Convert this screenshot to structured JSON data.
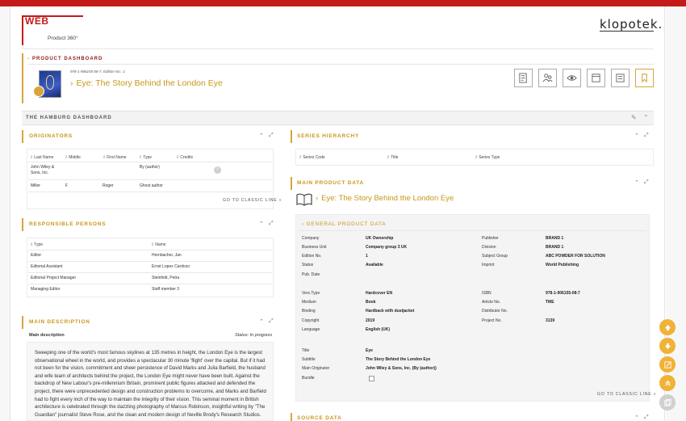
{
  "header": {
    "logo_web": "WEB",
    "logo_sub": "Product 360°",
    "brand": "klopotek."
  },
  "product_dashboard": {
    "label": "PRODUCT DASHBOARD",
    "isbn_line": "978-1-906155-08-7, Edition No.: 1",
    "title": "Eye: The Story Behind the London Eye",
    "tools": [
      "edit-document-icon",
      "users-icon",
      "eye-icon",
      "calendar-icon",
      "report-icon",
      "bookmark-icon"
    ]
  },
  "dashboard": {
    "title": "THE HAMBURG DASHBOARD"
  },
  "originators": {
    "title": "ORIGINATORS",
    "columns": [
      "Last Name",
      "Middle",
      "First Name",
      "Type",
      "Credits"
    ],
    "rows": [
      {
        "last": "John Wiley & Sons, Inc.",
        "middle": "",
        "first": "",
        "type": "By (author)",
        "credits": ""
      },
      {
        "last": "Miller",
        "middle": "F",
        "first": "Roger",
        "type": "Ghost author",
        "credits": ""
      }
    ],
    "classic": "GO TO CLASSIC LINE"
  },
  "series": {
    "title": "SERIES HIERARCHY",
    "columns": [
      "Series Code",
      "Title",
      "Series Type"
    ]
  },
  "responsible": {
    "title": "RESPONSIBLE PERSONS",
    "columns": [
      "Type",
      "Name"
    ],
    "rows": [
      {
        "type": "Editor",
        "name": "Hornbacher, Jan"
      },
      {
        "type": "Editorial Assistant",
        "name": "Ernst Lopes Cardozo"
      },
      {
        "type": "Editorial Project Manager",
        "name": "Steinfeld, Petra"
      },
      {
        "type": "Managing Editor",
        "name": "Staff member 3"
      }
    ]
  },
  "main_product": {
    "title": "MAIN PRODUCT DATA",
    "book_title": "Eye: The Story Behind the London Eye",
    "general_title": "GENERAL PRODUCT DATA",
    "left_fields": [
      {
        "label": "Company",
        "value": "UK Ownership"
      },
      {
        "label": "Business Unit",
        "value": "Company group 3 UK"
      },
      {
        "label": "Edition No.",
        "value": "1"
      },
      {
        "label": "Status",
        "value": "Available"
      },
      {
        "label": "Pub. Date",
        "value": ""
      },
      {
        "label": "Vers.Type",
        "value": "Hardcover EN"
      },
      {
        "label": "Medium",
        "value": "Book"
      },
      {
        "label": "Binding",
        "value": "Hardback with dustjacket"
      },
      {
        "label": "Copyright",
        "value": "2019"
      },
      {
        "label": "Language",
        "value": "English (UK)"
      },
      {
        "label": "Title",
        "value": "Eye"
      },
      {
        "label": "Subtitle",
        "value": "The Story Behind the London Eye"
      },
      {
        "label": "Main Originator",
        "value": "John Wiley & Sons, Inc. (By (author))"
      },
      {
        "label": "Bundle",
        "value": ""
      }
    ],
    "right_fields": [
      {
        "label": "Publisher",
        "value": "BRAND 1"
      },
      {
        "label": "Division",
        "value": "BRAND 1"
      },
      {
        "label": "Subject Group",
        "value": "ABC POWDER FOR SOLUTION"
      },
      {
        "label": "Imprint",
        "value": "World Publishing"
      },
      {
        "label": "ISBN",
        "value": "978-1-906155-08-7"
      },
      {
        "label": "Article No.",
        "value": "TME"
      },
      {
        "label": "Distributor No.",
        "value": ""
      },
      {
        "label": "Project No.",
        "value": "3139"
      }
    ],
    "classic": "GO TO CLASSIC LINE"
  },
  "description": {
    "title": "MAIN DESCRIPTION",
    "subtitle": "Main description",
    "status": "Status: In progress",
    "text": "Sweeping one of the world's most famous skylines at 135 metres in height, the London Eye is the largest observational wheel in the world, and provides a spectacular 30 minute 'flight' over the capital. But if it had not been for the vision, commitment and sheer persistence of David Marks and Julia Barfield, the husband and wife team of architects behind the project, the London Eye might never have been built. Against the backdrop of New Labour's pre-millennium Britain, prominent public figures attacked and defended the project, there were unprecedented design and construction problems to overcome, and Marks and Barfield had to fight every inch of the way to maintain the integrity of their vision. This seminal moment in British architecture is celebrated through the dazzling photography of Marcus Robinson, insightful writing by \"The Guardian\" journalist Steve Rose, and the clean and modern design of Neville Brody's Research Studios."
  },
  "source": {
    "title": "SOURCE DATA"
  },
  "side_buttons": [
    "arrow-up-icon",
    "arrow-down-icon",
    "edit-icon",
    "double-up-icon",
    "copy-icon"
  ],
  "colors": {
    "accent": "#d9a43a",
    "brand_red": "#c41a1a",
    "title_gold": "#c9961a"
  }
}
